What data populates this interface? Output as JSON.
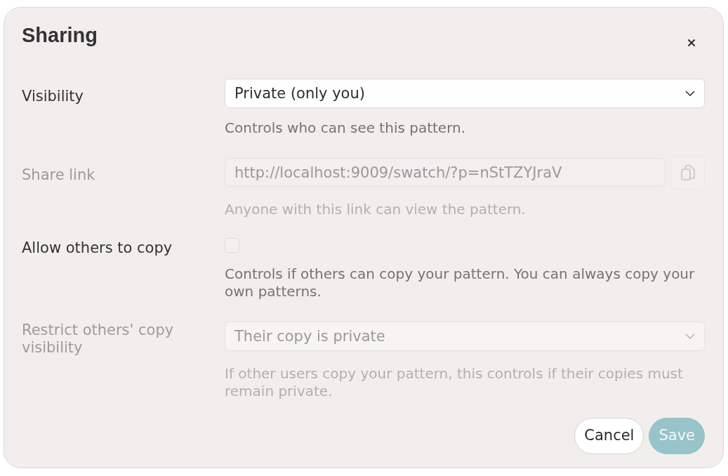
{
  "dialog": {
    "title": "Sharing"
  },
  "fields": [
    {
      "kind": "select",
      "label": "Visibility",
      "value": "Private (only you)",
      "help": "Controls who can see this pattern.",
      "disabled": false
    },
    {
      "kind": "link",
      "label": "Share link",
      "value": "http://localhost:9009/swatch/?p=nStTZYJraV",
      "help": "Anyone with this link can view the pattern.",
      "disabled": true
    },
    {
      "kind": "checkbox",
      "label": "Allow others to copy",
      "checked": false,
      "help": "Controls if others can copy your pattern. You can always copy your own patterns.",
      "disabled": false
    },
    {
      "kind": "select",
      "label": "Restrict others' copy visibility",
      "value": "Their copy is private",
      "help": "If other users copy your pattern, this controls if their copies must remain private.",
      "disabled": true
    }
  ],
  "buttons": [
    {
      "kind": "secondary",
      "label": "Cancel",
      "disabled": false
    },
    {
      "kind": "primary",
      "label": "Save",
      "disabled": true
    }
  ]
}
